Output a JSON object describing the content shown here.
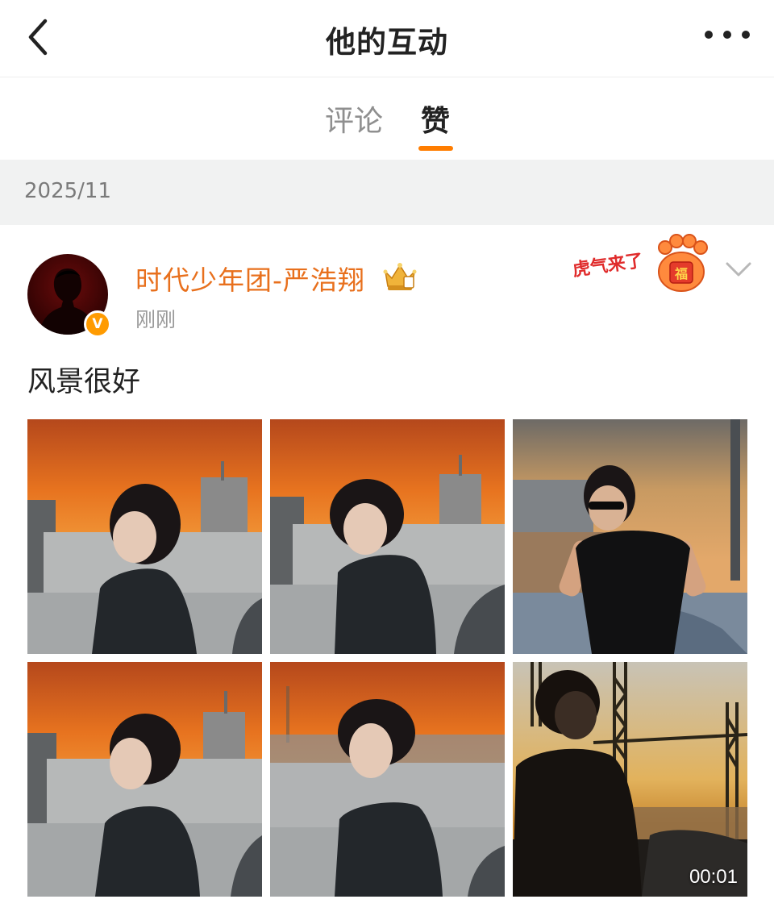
{
  "header": {
    "title": "他的互动",
    "back_icon": "chevron-left-icon",
    "more_icon": "more-dots-icon"
  },
  "tabs": [
    {
      "label": "评论",
      "active": false
    },
    {
      "label": "赞",
      "active": true
    }
  ],
  "accent_color": "#ff7d00",
  "month_label": "2025/11",
  "post": {
    "author": "时代少年团-严浩翔",
    "author_color": "#e8701d",
    "verified_icon": "verified-v-badge-icon",
    "verified_letter": "V",
    "badge_icon": "crown-badge-icon",
    "time": "刚刚",
    "pendant_text": "虎气来了",
    "pendant_stamp": "福",
    "menu_icon": "chevron-down-icon",
    "text": "风景很好",
    "images": [
      {
        "name": "photo-1",
        "kind": "image"
      },
      {
        "name": "photo-2",
        "kind": "image"
      },
      {
        "name": "photo-3",
        "kind": "image"
      },
      {
        "name": "photo-4",
        "kind": "image"
      },
      {
        "name": "photo-5",
        "kind": "image"
      },
      {
        "name": "video-6",
        "kind": "video",
        "duration": "00:01"
      }
    ]
  }
}
